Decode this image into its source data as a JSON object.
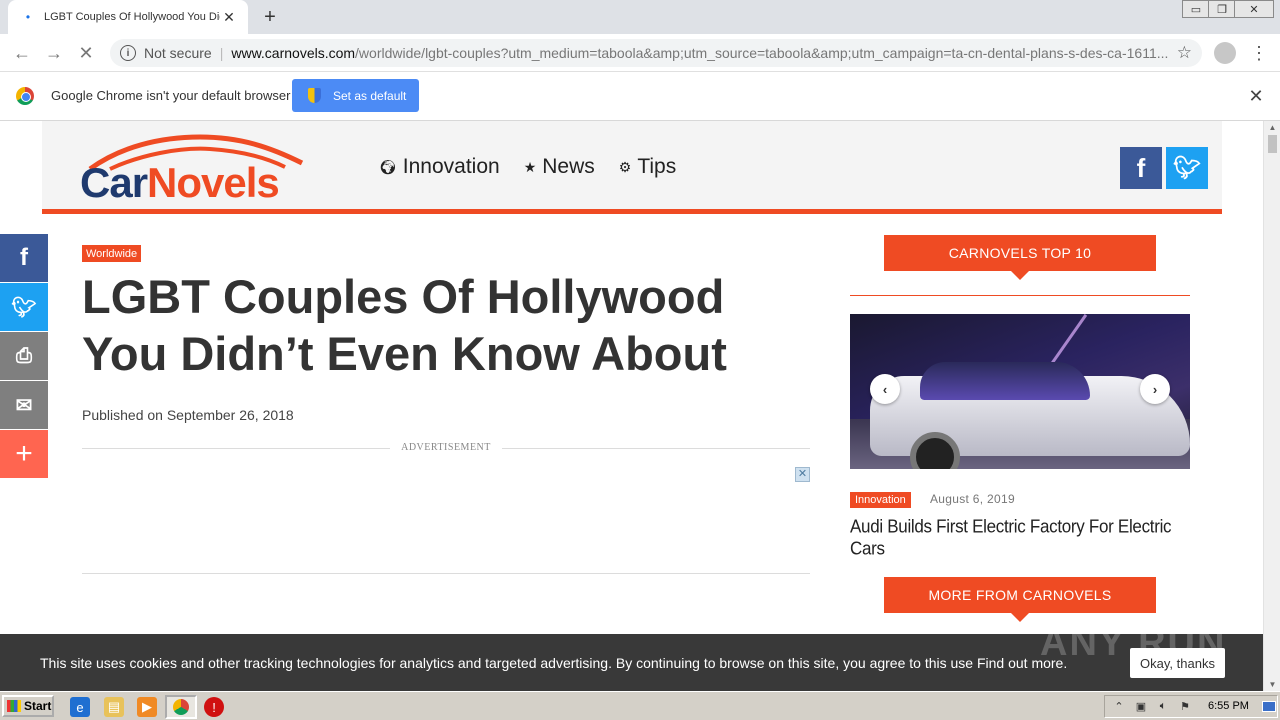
{
  "browser": {
    "tab_title": "LGBT Couples Of Hollywood You Didn",
    "omnibox": {
      "security_text": "Not secure",
      "url_host": "www.carnovels.com",
      "url_path": "/worldwide/lgbt-couples?utm_medium=taboola&amp;utm_source=taboola&amp;utm_campaign=ta-cn-dental-plans-s-des-ca-1611..."
    },
    "infobar": {
      "message": "Google Chrome isn't your default browser",
      "button_label": "Set as default"
    },
    "window_controls": [
      "▭",
      "❐",
      "✕"
    ]
  },
  "site": {
    "logo": {
      "part1": "Car",
      "part2": "Novels"
    },
    "nav": [
      {
        "label": "Innovation",
        "icon": "globe-icon",
        "glyph": "🌍︎"
      },
      {
        "label": "News",
        "icon": "star-icon",
        "glyph": "★"
      },
      {
        "label": "Tips",
        "icon": "gears-icon",
        "glyph": "⚙"
      }
    ],
    "social_header": {
      "facebook": "f",
      "twitter": "🐦︎"
    }
  },
  "share_bar": [
    "f",
    "🐦︎",
    "⎙",
    "✉",
    "+"
  ],
  "article": {
    "category": "Worldwide",
    "title": "LGBT Couples Of Hollywood You Didn’t Even Know About",
    "published": "Published on September 26, 2018",
    "ad_label": "ADVERTISEMENT"
  },
  "sidebar": {
    "top10_heading": "CARNOVELS TOP 10",
    "slide": {
      "category": "Innovation",
      "date": "August 6, 2019",
      "title": "Audi Builds First Electric Factory For Electric Cars"
    },
    "more_heading": "MORE FROM CARNOVELS"
  },
  "cookie_bar": {
    "message": "This site uses cookies and other tracking technologies for analytics and targeted advertising. By continuing to browse on this site, you agree to this use Find out more.",
    "button": "Okay, thanks",
    "watermark": "ANY RUN"
  },
  "taskbar": {
    "start_label": "Start",
    "clock": "6:55 PM"
  },
  "colors": {
    "accent": "#ef4b23",
    "logo_blue": "#1f3a6e",
    "facebook": "#3b5998",
    "twitter": "#1da1f2",
    "chrome_blue": "#4c8bf5"
  }
}
